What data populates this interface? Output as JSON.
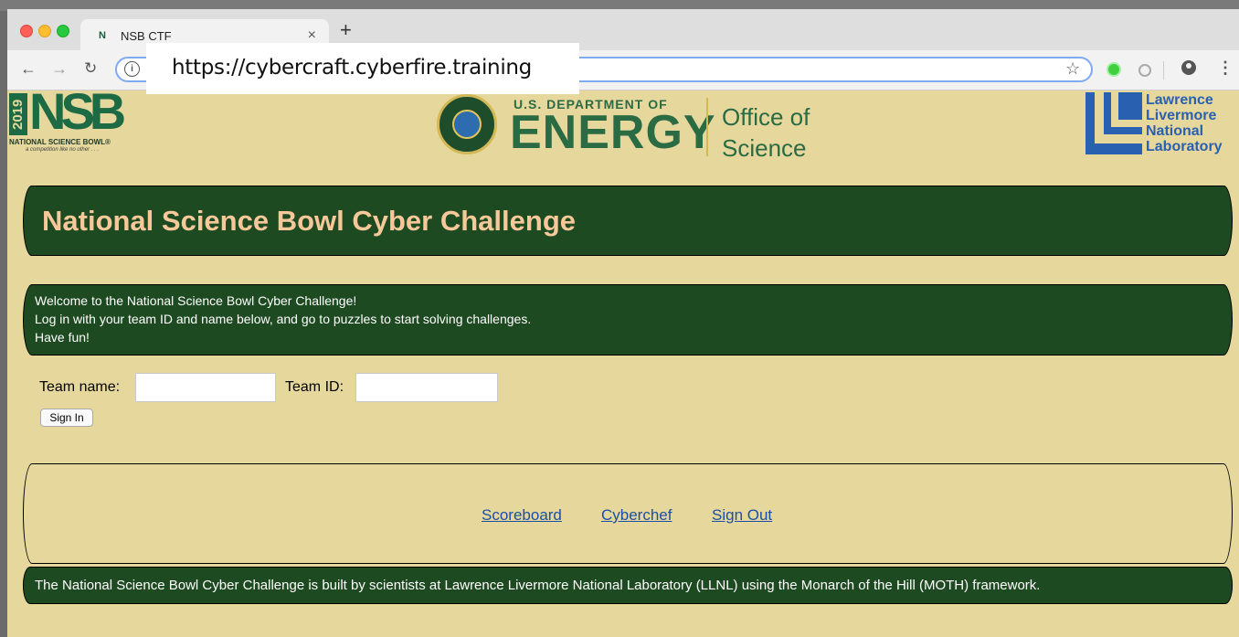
{
  "browser": {
    "tab_title": "NSB CTF",
    "tab_favicon_text": "N",
    "new_tab_symbol": "+",
    "close_tab_symbol": "×",
    "url": "https://cybercraft.cyberfire.training"
  },
  "logos": {
    "nsb_year": "2019",
    "nsb_letters": "NSB",
    "nsb_name": "NATIONAL SCIENCE BOWL®",
    "nsb_tagline": "a competition like no other . . .",
    "doe_dept": "U.S. DEPARTMENT OF",
    "doe_energy": "ENERGY",
    "doe_office_line1": "Office of",
    "doe_office_line2": "Science",
    "llnl_line1": "Lawrence",
    "llnl_line2": "Livermore",
    "llnl_line3": "National",
    "llnl_line4": "Laboratory"
  },
  "title": "National Science Bowl Cyber Challenge",
  "welcome": {
    "line1": "Welcome to the National Science Bowl Cyber Challenge!",
    "line2": "Log in with your team ID and name below, and go to puzzles to start solving challenges.",
    "line3": "Have fun!"
  },
  "form": {
    "team_name_label": "Team name:",
    "team_name_value": "",
    "team_id_label": "Team ID:",
    "team_id_value": "",
    "sign_in_label": "Sign In"
  },
  "nav": {
    "scoreboard": "Scoreboard",
    "cyberchef": "Cyberchef",
    "sign_out": "Sign Out"
  },
  "footer": "The National Science Bowl Cyber Challenge is built by scientists at Lawrence Livermore National Laboratory (LLNL) using the Monarch of the Hill (MOTH) framework.",
  "colors": {
    "page_bg": "#e6d79c",
    "banner_bg": "#1d4a20",
    "title_text": "#f7c89a",
    "link": "#1a4fa6"
  }
}
